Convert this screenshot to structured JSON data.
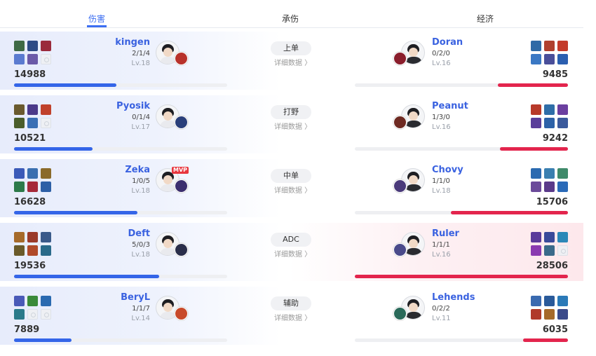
{
  "tabs": {
    "damage": "伤害",
    "taken": "承伤",
    "economy": "经济"
  },
  "detail_label": "详细数据 〉",
  "rows": [
    {
      "role": "上单",
      "left": {
        "name": "kingen",
        "kda": "2/1/4",
        "level": "Lv.18",
        "value": "14988",
        "bar": 0.48,
        "items": [
          "#3f6a45",
          "#2d4b86",
          "#9a2a3b",
          "#5b7bd0",
          "#6b5aa8",
          "empty"
        ],
        "champ": "#b8322b"
      },
      "right": {
        "name": "Doran",
        "kda": "0/2/0",
        "level": "Lv.16",
        "value": "9485",
        "bar": 0.33,
        "items": [
          "#2f6aa6",
          "#b0402e",
          "#c43b2b",
          "#3a78c4",
          "#4a4f9a",
          "#2b5fb0"
        ],
        "champ": "#8a1e2c"
      }
    },
    {
      "role": "打野",
      "left": {
        "name": "Pyosik",
        "kda": "0/1/4",
        "level": "Lv.17",
        "value": "10521",
        "bar": 0.37,
        "items": [
          "#6a5a2e",
          "#4b3a8a",
          "#c0412b",
          "#4a5d2b",
          "#3a6fb5",
          "empty"
        ],
        "champ": "#2a3f7a"
      },
      "right": {
        "name": "Peanut",
        "kda": "1/3/0",
        "level": "Lv.16",
        "value": "9242",
        "bar": 0.32,
        "items": [
          "#b83a2a",
          "#2f6ea8",
          "#6b3fa0",
          "#5a3e9a",
          "#2d62a8",
          "#3b5a9c"
        ],
        "champ": "#6e2a22"
      }
    },
    {
      "role": "中单",
      "left": {
        "name": "Zeka",
        "kda": "1/0/5",
        "level": "Lv.18",
        "value": "16628",
        "bar": 0.58,
        "mvp": "MVP",
        "items": [
          "#3b5ab8",
          "#3a6fb0",
          "#8a6a2a",
          "#2d7a4a",
          "#a62a3a",
          "#2d5fa6"
        ],
        "champ": "#3c2f6e"
      },
      "right": {
        "name": "Chovy",
        "kda": "1/1/0",
        "level": "Lv.18",
        "value": "15706",
        "bar": 0.55,
        "items": [
          "#2b6ab0",
          "#3a7fb0",
          "#3f8a6a",
          "#6b4a9a",
          "#5a3a8a",
          "#2a6ab8"
        ],
        "champ": "#4a3a7a"
      }
    },
    {
      "role": "ADC",
      "left": {
        "name": "Deft",
        "kda": "5/0/3",
        "level": "Lv.18",
        "value": "19536",
        "bar": 0.68,
        "items": [
          "#a66a2a",
          "#9a3a2a",
          "#3a5a8a",
          "#6a5a2a",
          "#b04a2a",
          "#2a6a8a"
        ],
        "champ": "#2a2e4a"
      },
      "right": {
        "name": "Ruler",
        "kda": "1/1/1",
        "level": "Lv.16",
        "value": "28506",
        "bar": 1.0,
        "items": [
          "#5a3a9a",
          "#3a4a9a",
          "#2b88b8",
          "#8a3ab0",
          "#3a6a8a",
          "empty"
        ],
        "champ": "#4a4a8a"
      }
    },
    {
      "role": "辅助",
      "left": {
        "name": "BeryL",
        "kda": "1/1/7",
        "level": "Lv.14",
        "value": "7889",
        "bar": 0.27,
        "items": [
          "#4a5ab8",
          "#3a8a3a",
          "#2a6ab0",
          "#2a7a8a",
          "empty",
          "empty"
        ],
        "champ": "#c84a2a"
      },
      "right": {
        "name": "Lehends",
        "kda": "0/2/2",
        "level": "Lv.11",
        "value": "6035",
        "bar": 0.21,
        "items": [
          "#3a6ab0",
          "#2a5a9a",
          "#2b7ab8",
          "#b03a2a",
          "#a66a2a",
          "#3a4a8a"
        ],
        "champ": "#2a6a5a"
      }
    }
  ]
}
